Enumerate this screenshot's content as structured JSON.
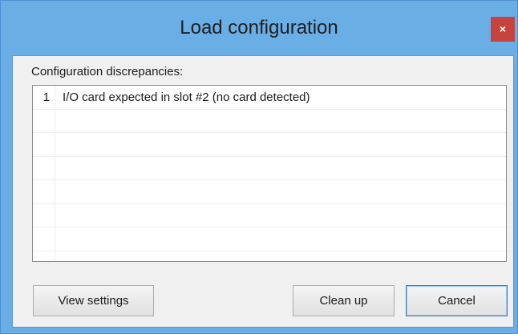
{
  "window": {
    "title": "Load configuration",
    "close_label": "×"
  },
  "panel": {
    "label": "Configuration discrepancies:",
    "rows": [
      {
        "num": "1",
        "text": "I/O card expected in slot #2 (no card detected)"
      },
      {
        "num": "",
        "text": ""
      },
      {
        "num": "",
        "text": ""
      },
      {
        "num": "",
        "text": ""
      },
      {
        "num": "",
        "text": ""
      },
      {
        "num": "",
        "text": ""
      },
      {
        "num": "",
        "text": ""
      },
      {
        "num": "",
        "text": ""
      }
    ]
  },
  "buttons": {
    "view_settings": "View settings",
    "clean_up": "Clean up",
    "cancel": "Cancel"
  },
  "colors": {
    "title_bar": "#6aaee6",
    "close_button": "#c7433d",
    "client_background": "#f0f0f0"
  }
}
